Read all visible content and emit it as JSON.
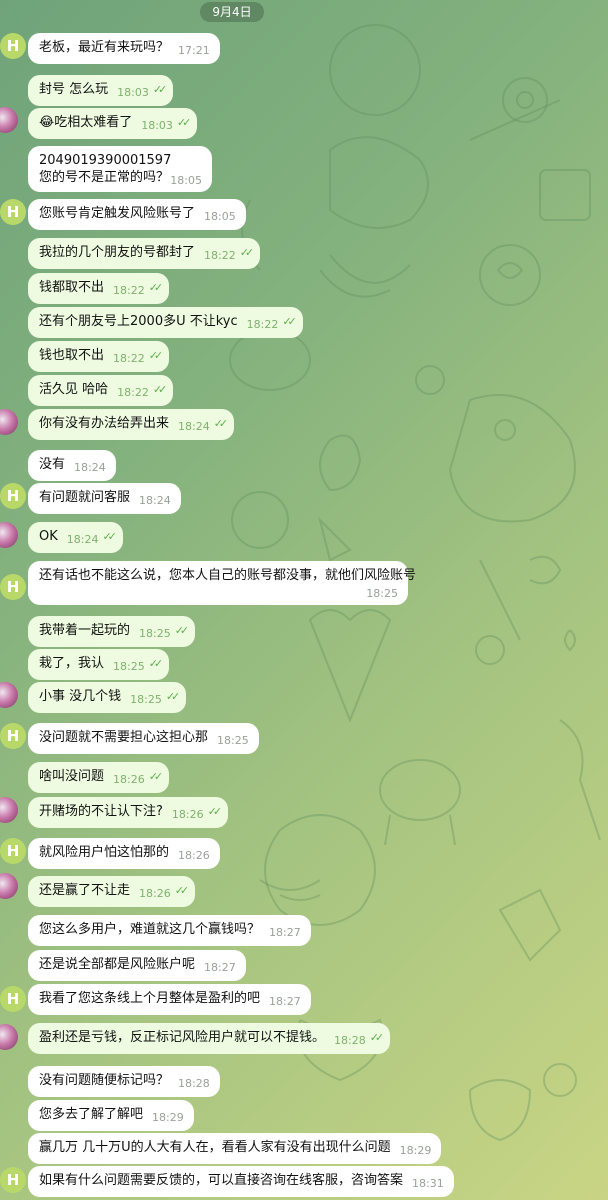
{
  "date_badge": "9月4日",
  "avatar_letter": "H",
  "messages": [
    {
      "text": "老板，最近有来玩吗？",
      "time": "17:21"
    },
    {
      "text": "封号 怎么玩",
      "time": "18:03"
    },
    {
      "text": "😂吃相太难看了",
      "time": "18:03"
    },
    {
      "line1": "2049019390001597",
      "line2": "您的号不是正常的吗？",
      "time": "18:05"
    },
    {
      "text": "您账号肯定触发风险账号了",
      "time": "18:05"
    },
    {
      "text": "我拉的几个朋友的号都封了",
      "time": "18:22"
    },
    {
      "text": "钱都取不出",
      "time": "18:22"
    },
    {
      "text": "还有个朋友号上2000多U 不让kyc",
      "time": "18:22"
    },
    {
      "text": "钱也取不出",
      "time": "18:22"
    },
    {
      "text": "活久见 哈哈",
      "time": "18:22"
    },
    {
      "text": "你有没有办法给弄出来",
      "time": "18:24"
    },
    {
      "text": "没有",
      "time": "18:24"
    },
    {
      "text": "有问题就问客服",
      "time": "18:24"
    },
    {
      "text": "OK",
      "time": "18:24"
    },
    {
      "text": "还有话也不能这么说，您本人自己的账号都没事，就他们风险账号",
      "time": "18:25"
    },
    {
      "text": "我带着一起玩的",
      "time": "18:25"
    },
    {
      "text": "栽了，我认",
      "time": "18:25"
    },
    {
      "text": "小事 没几个钱",
      "time": "18:25"
    },
    {
      "text": "没问题就不需要担心这担心那",
      "time": "18:25"
    },
    {
      "text": "啥叫没问题",
      "time": "18:26"
    },
    {
      "text": "开赌场的不让认下注?",
      "time": "18:26"
    },
    {
      "text": "就风险用户怕这怕那的",
      "time": "18:26"
    },
    {
      "text": "还是赢了不让走",
      "time": "18:26"
    },
    {
      "text": "您这么多用户，难道就这几个赢钱吗？",
      "time": "18:27"
    },
    {
      "text": "还是说全部都是风险账户呢",
      "time": "18:27"
    },
    {
      "text": "我看了您这条线上个月整体是盈利的吧",
      "time": "18:27"
    },
    {
      "text": "盈利还是亏钱，反正标记风险用户就可以不提钱。",
      "time": "18:28"
    },
    {
      "text": "没有问题随便标记吗？",
      "time": "18:28"
    },
    {
      "text": "您多去了解了解吧",
      "time": "18:29"
    },
    {
      "text": "赢几万 几十万U的人大有人在，看看人家有没有出现什么问题",
      "time": "18:29"
    },
    {
      "text": "如果有什么问题需要反馈的，可以直接咨询在线客服，咨询答案",
      "time": "18:31"
    }
  ]
}
